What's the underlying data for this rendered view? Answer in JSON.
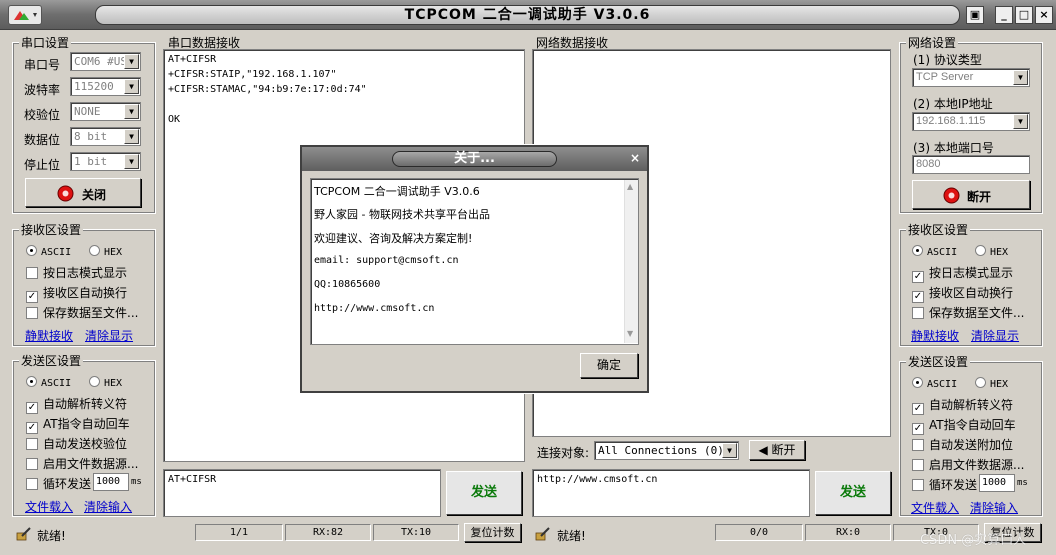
{
  "window": {
    "title": "TCPCOM  二合一调试助手  V3.0.6",
    "pin": "▣",
    "minimize": "_",
    "maximize": "□",
    "close": "×"
  },
  "serial": {
    "title": "串口设置",
    "port_label": "串口号",
    "port_value": "COM6 #USB",
    "baud_label": "波特率",
    "baud_value": "115200",
    "parity_label": "校验位",
    "parity_value": "NONE",
    "databits_label": "数据位",
    "databits_value": "8 bit",
    "stopbits_label": "停止位",
    "stopbits_value": "1 bit",
    "close_button": "关闭"
  },
  "serial_recv_settings": {
    "title": "接收区设置",
    "ascii": "ASCII",
    "hex": "HEX",
    "log_mode": "按日志模式显示",
    "auto_wrap": "接收区自动换行",
    "save_to_file": "保存数据至文件...",
    "silent_recv": "静默接收",
    "clear_display": "清除显示"
  },
  "serial_send_settings": {
    "title": "发送区设置",
    "ascii": "ASCII",
    "hex": "HEX",
    "auto_escape": "自动解析转义符",
    "at_auto_enter": "AT指令自动回车",
    "auto_checksum": "自动发送校验位",
    "file_source": "启用文件数据源...",
    "loop_send": "循环发送",
    "loop_value": "1000",
    "loop_unit": "ms",
    "file_load": "文件载入",
    "clear_input": "清除输入"
  },
  "serial_receive": {
    "title": "串口数据接收",
    "content": "AT+CIFSR\n+CIFSR:STAIP,\"192.168.1.107\"\n+CIFSR:STAMAC,\"94:b9:7e:17:0d:74\"\n\nOK"
  },
  "serial_send": {
    "content": "AT+CIFSR",
    "send_button": "发送"
  },
  "network_receive": {
    "title": "网络数据接收",
    "connect_label": "连接对象:",
    "connect_value": "All Connections (0)",
    "disconnect_button": "断开"
  },
  "network_send": {
    "content": "http://www.cmsoft.cn",
    "send_button": "发送"
  },
  "network": {
    "title": "网络设置",
    "protocol_label": "(1) 协议类型",
    "protocol_value": "TCP Server",
    "ip_label": "(2) 本地IP地址",
    "ip_value": "192.168.1.115",
    "port_label": "(3) 本地端口号",
    "port_value": "8080",
    "disconnect_button": "断开"
  },
  "net_recv_settings": {
    "title": "接收区设置",
    "ascii": "ASCII",
    "hex": "HEX",
    "log_mode": "按日志模式显示",
    "auto_wrap": "接收区自动换行",
    "save_to_file": "保存数据至文件...",
    "silent_recv": "静默接收",
    "clear_display": "清除显示"
  },
  "net_send_settings": {
    "title": "发送区设置",
    "ascii": "ASCII",
    "hex": "HEX",
    "auto_escape": "自动解析转义符",
    "at_auto_enter": "AT指令自动回车",
    "auto_append": "自动发送附加位",
    "file_source": "启用文件数据源...",
    "loop_send": "循环发送",
    "loop_value": "1000",
    "loop_unit": "ms",
    "file_load": "文件载入",
    "clear_input": "清除输入"
  },
  "status_serial": {
    "ready": "就绪!",
    "pages": "1/1",
    "rx": "RX:82",
    "tx": "TX:10",
    "reset": "复位计数"
  },
  "status_net": {
    "ready": "就绪!",
    "pages": "0/0",
    "rx": "RX:0",
    "tx": "TX:0",
    "reset": "复位计数"
  },
  "watermark": "CSDN @实算口人",
  "about": {
    "title": "关于...",
    "close": "×",
    "line1": "TCPCOM 二合一调试助手 V3.0.6",
    "line2": "野人家园 - 物联网技术共享平台出品",
    "line3": "欢迎建议、咨询及解决方案定制!",
    "line4": "email: support@cmsoft.cn",
    "line5": "QQ:10865600",
    "line6": "http://www.cmsoft.cn",
    "ok_button": "确定"
  }
}
